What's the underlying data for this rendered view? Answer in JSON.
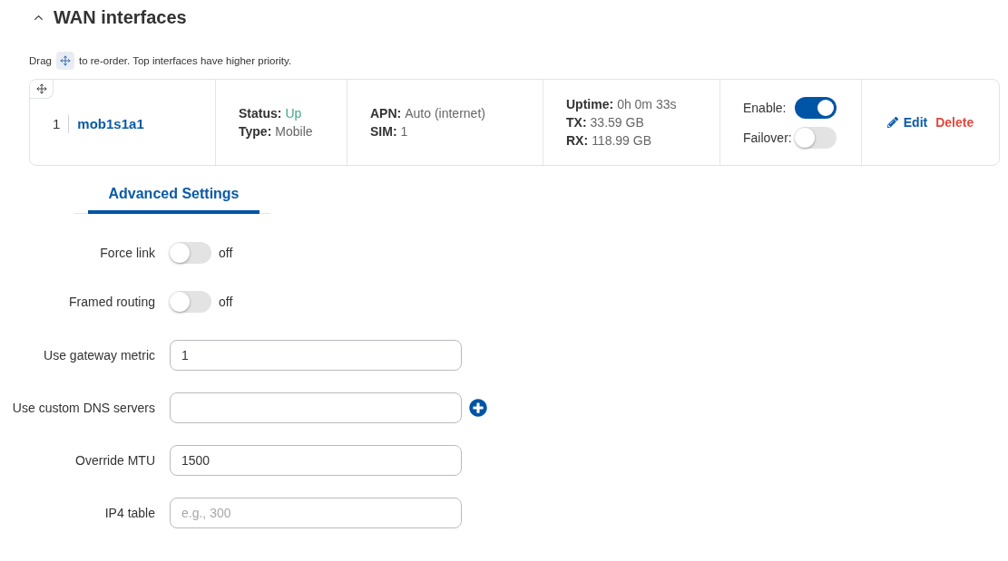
{
  "section": {
    "title": "WAN interfaces",
    "expanded": true
  },
  "hint": {
    "text_before": "Drag",
    "text_after": "to re-order. Top interfaces have higher priority."
  },
  "interfaces": [
    {
      "number": "1",
      "name": "mob1s1a1",
      "details": [
        {
          "items": [
            {
              "label": "Status:",
              "value": "Up",
              "kind": "status",
              "ok": true
            },
            {
              "label": "Type:",
              "value": "Mobile",
              "kind": "plain"
            }
          ]
        },
        {
          "items": [
            {
              "label": "APN:",
              "value": "Auto (internet)",
              "kind": "plain"
            },
            {
              "label": "SIM:",
              "value": "1",
              "kind": "plain"
            }
          ]
        },
        {
          "items": [
            {
              "label": "Uptime:",
              "value": "0h 0m 33s",
              "kind": "plain"
            },
            {
              "label": "TX:",
              "value": "33.59 GB",
              "kind": "plain"
            },
            {
              "label": "RX:",
              "value": "118.99 GB",
              "kind": "plain"
            }
          ]
        }
      ],
      "switches": [
        {
          "label": "Enable:",
          "on": true
        },
        {
          "label": "Failover:",
          "on": false
        }
      ],
      "actions": [
        {
          "label": "Edit",
          "kind": "edit"
        },
        {
          "label": "Delete",
          "kind": "delete"
        }
      ]
    }
  ],
  "tabs": [
    {
      "label": "Advanced Settings",
      "selected": true
    }
  ],
  "settings": [
    {
      "kind": "switch",
      "label": "Force link",
      "on": false,
      "state_text": "off"
    },
    {
      "kind": "switch",
      "label": "Framed routing",
      "on": false,
      "state_text": "off"
    },
    {
      "kind": "input",
      "label": "Use gateway metric",
      "value": "1"
    },
    {
      "kind": "input",
      "label": "Use custom DNS servers",
      "add_button": true
    },
    {
      "kind": "input",
      "label": "Override MTU",
      "value": "1500"
    },
    {
      "kind": "input",
      "label": "IP4 table",
      "placeholder": "e.g., 300"
    }
  ]
}
